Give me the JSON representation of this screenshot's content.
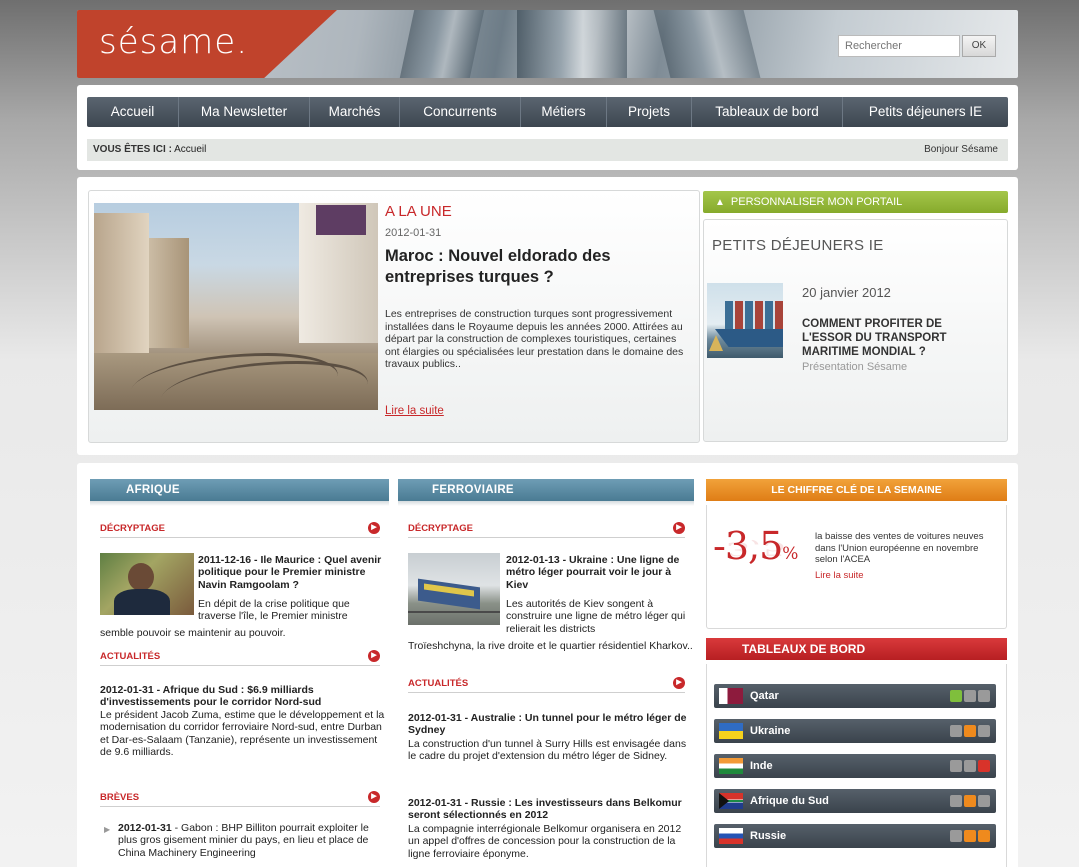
{
  "header": {
    "logo": "sésame.",
    "search_placeholder": "Rechercher",
    "search_button": "OK"
  },
  "nav": {
    "items": [
      "Accueil",
      "Ma Newsletter",
      "Marchés",
      "Concurrents",
      "Métiers",
      "Projets",
      "Tableaux de bord",
      "Petits déjeuners IE"
    ]
  },
  "breadcrumb": {
    "label": "VOUS ÊTES ICI :",
    "current": " Accueil",
    "greeting": "Bonjour Sésame"
  },
  "featured": {
    "kicker": "A LA UNE",
    "date": "2012-01-31",
    "title": "Maroc : Nouvel eldorado des entreprises turques ?",
    "body": "Les entreprises de construction turques sont progressivement installées dans le Royaume depuis les années 2000. Attirées au départ par la construction de complexes touristiques, certaines ont élargies ou spécialisées leur prestation dans le domaine des travaux publics..",
    "link": "Lire la suite"
  },
  "portal": {
    "personalize": "PERSONNALISER MON PORTAIL",
    "title": "PETITS DÉJEUNERS IE",
    "date": "20 janvier 2012",
    "headline": "COMMENT PROFITER DE L'ESSOR DU TRANSPORT MARITIME MONDIAL ?",
    "sub": "Présentation Sésame"
  },
  "afrique": {
    "header": "AFRIQUE",
    "decryptage_title": "DÉCRYPTAGE",
    "decryptage_head": "2011-12-16 - Ile Maurice : Quel avenir politique pour le Premier ministre Navin Ramgoolam ?",
    "decryptage_body": "En dépit de la crise politique que traverse l'île, le Premier ministre semble pouvoir se maintenir au pouvoir.",
    "actualites_title": "ACTUALITÉS",
    "actu_head": "2012-01-31 - Afrique du Sud : $6.9 milliards d'investissements pour le corridor Nord-sud",
    "actu_body": "Le président Jacob Zuma, estime que le développement et la modernisation du corridor ferroviaire Nord-sud, entre Durban et Dar-es-Salaam (Tanzanie), représente un investissement de 9.6 milliards.",
    "breves_title": "BRÈVES",
    "breve_date": "2012-01-31",
    "breve_body": " - Gabon : BHP Billiton pourrait exploiter le plus gros gisement minier du pays, en lieu et place de China Machinery Engineering"
  },
  "ferroviaire": {
    "header": "FERROVIAIRE",
    "decryptage_title": "DÉCRYPTAGE",
    "decryptage_head": "2012-01-13 - Ukraine : Une ligne de métro léger pourrait voir le jour à Kiev",
    "decryptage_body_short": "Les autorités de Kiev songent à construire une ligne de métro léger qui relierait les districts",
    "decryptage_body_rest": "Troïeshchyna, la rive droite et le quartier résidentiel Kharkov..",
    "actualites_title": "ACTUALITÉS",
    "actu1_head": "2012-01-31 - Australie : Un tunnel pour le métro léger de Sydney",
    "actu1_body": "La construction d'un tunnel à Surry Hills est envisagée dans le cadre du projet d'extension du métro léger de Sidney.",
    "actu2_head": "2012-01-31 - Russie : Les investisseurs dans Belkomur seront sélectionnés en 2012",
    "actu2_body": "La compagnie interrégionale Belkomur organisera en 2012 un appel d'offres de concession pour la construction de la ligne ferroviaire éponyme."
  },
  "key_figure": {
    "header": "LE CHIFFRE CLÉ DE LA SEMAINE",
    "value": "-3,5",
    "unit": "%",
    "desc": "la baisse des ventes de voitures neuves dans l'Union européenne en novembre selon l'ACEA",
    "link": "Lire la suite"
  },
  "dashboards": {
    "header": "TABLEAUX DE BORD",
    "rows": [
      {
        "label": "Qatar",
        "lights": [
          "#7fbf3c",
          "#9a9a9a",
          "#9a9a9a"
        ]
      },
      {
        "label": "Ukraine",
        "lights": [
          "#9a9a9a",
          "#ef8a1d",
          "#9a9a9a"
        ]
      },
      {
        "label": "Inde",
        "lights": [
          "#9a9a9a",
          "#9a9a9a",
          "#d8332a"
        ]
      },
      {
        "label": "Afrique du Sud",
        "lights": [
          "#9a9a9a",
          "#ef8a1d",
          "#9a9a9a"
        ]
      },
      {
        "label": "Russie",
        "lights": [
          "#9a9a9a",
          "#ef8a1d",
          "#ef8a1d"
        ]
      }
    ]
  },
  "colors": {
    "accent_red": "#c8282a",
    "nav_bg": "#3d4650",
    "green": "#86aa2c",
    "orange": "#df7d16",
    "section_blue": "#4a7b93"
  }
}
